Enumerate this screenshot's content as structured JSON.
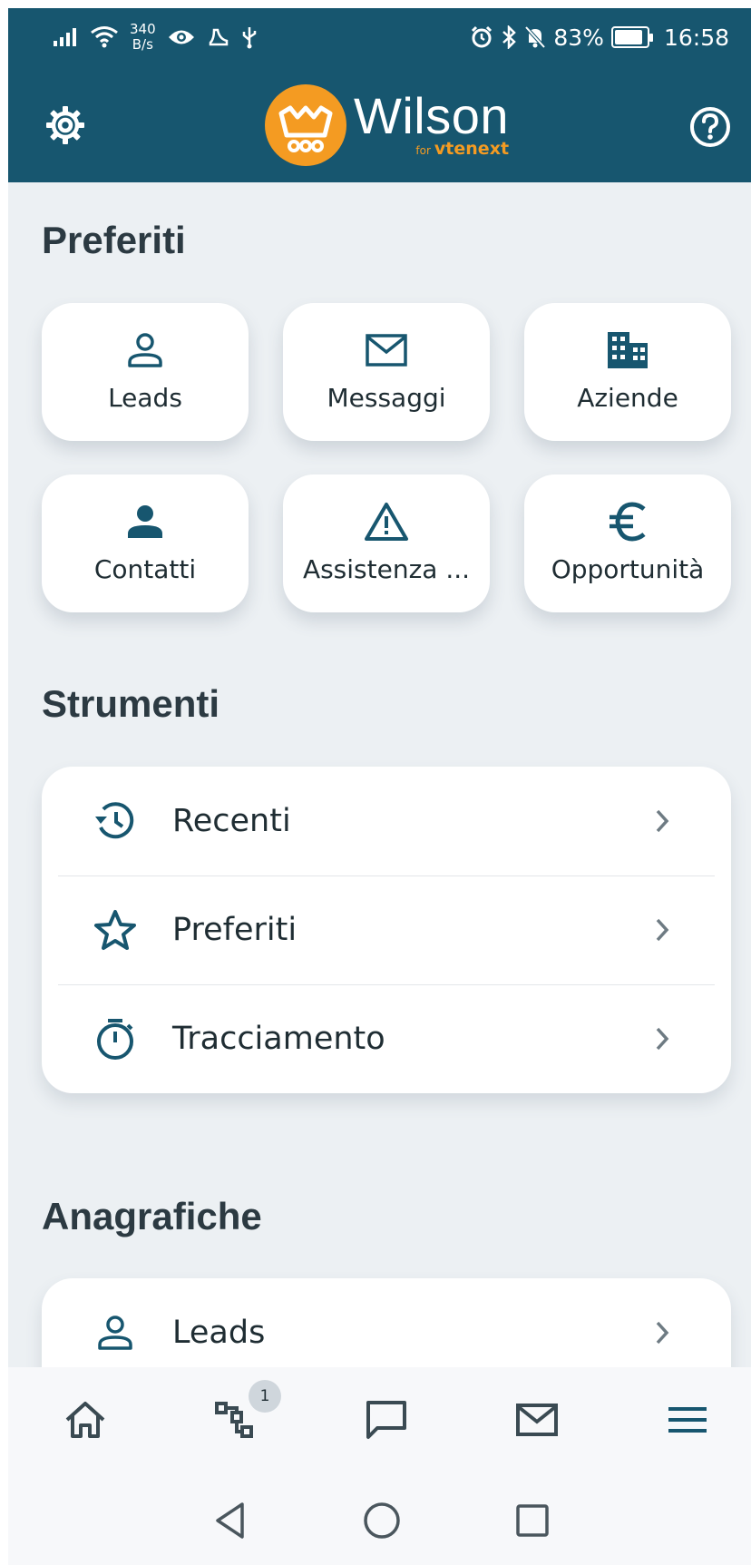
{
  "status_bar": {
    "net_speed_value": "340",
    "net_speed_unit": "B/s",
    "battery": "83%",
    "battery_level": 0.83,
    "time": "16:58"
  },
  "header": {
    "logo_title": "Wilson",
    "logo_for": "for",
    "logo_brand": "vtenext",
    "settings_icon": "gear-icon",
    "help_icon": "help-icon"
  },
  "colors": {
    "header_bg": "#17566f",
    "accent_orange": "#f49b22",
    "icon_blue": "#17566f",
    "page_bg": "#ecf0f3"
  },
  "favorites": {
    "title": "Preferiti",
    "items": [
      {
        "label": "Leads",
        "icon": "user-outline-icon"
      },
      {
        "label": "Messaggi",
        "icon": "envelope-icon"
      },
      {
        "label": "Aziende",
        "icon": "building-icon"
      },
      {
        "label": "Contatti",
        "icon": "user-filled-icon"
      },
      {
        "label": "Assistenza ...",
        "icon": "warning-icon"
      },
      {
        "label": "Opportunità",
        "icon": "euro-icon"
      }
    ]
  },
  "tools": {
    "title": "Strumenti",
    "items": [
      {
        "label": "Recenti",
        "icon": "history-icon"
      },
      {
        "label": "Preferiti",
        "icon": "star-icon"
      },
      {
        "label": "Tracciamento",
        "icon": "stopwatch-icon"
      }
    ]
  },
  "registry": {
    "title": "Anagrafiche",
    "items": [
      {
        "label": "Leads",
        "icon": "user-outline-icon"
      }
    ]
  },
  "bottom_nav": {
    "items": [
      {
        "name": "home",
        "icon": "home-icon"
      },
      {
        "name": "processes",
        "icon": "flowchart-icon",
        "badge": "1"
      },
      {
        "name": "chat",
        "icon": "chat-icon"
      },
      {
        "name": "mail",
        "icon": "mail-icon"
      },
      {
        "name": "menu",
        "icon": "menu-icon"
      }
    ]
  }
}
